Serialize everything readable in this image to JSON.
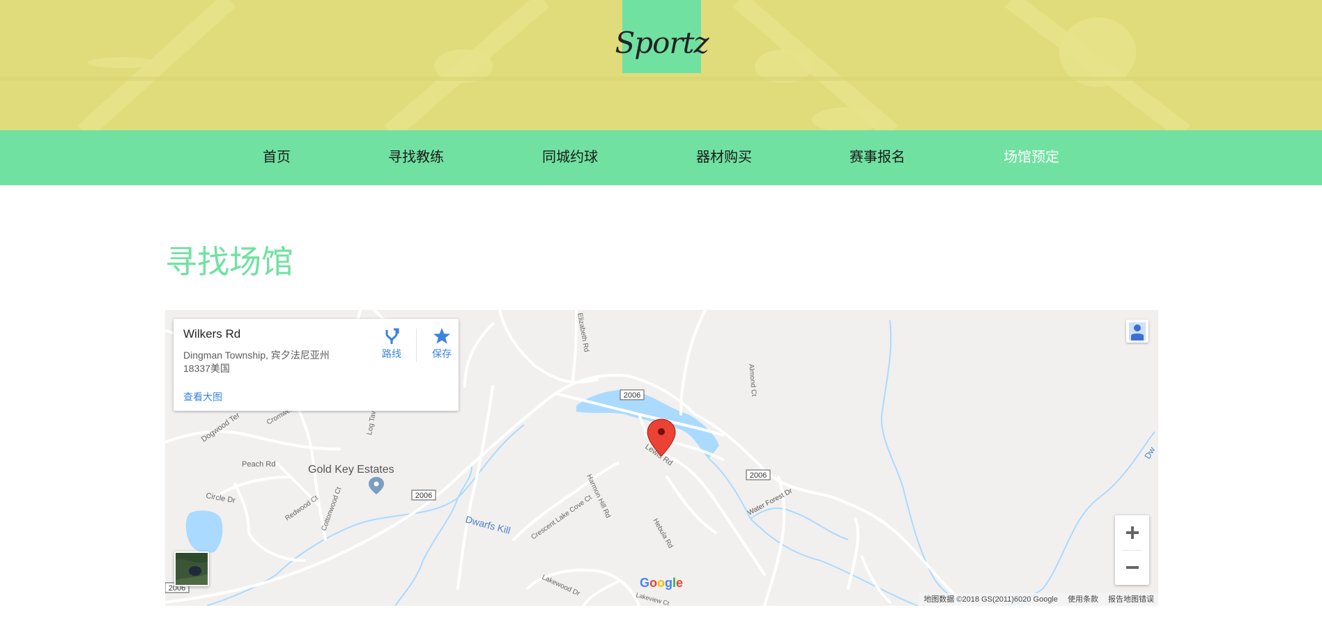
{
  "brand": {
    "logo_text": "Sportz"
  },
  "nav": {
    "items": [
      {
        "label": "首页"
      },
      {
        "label": "寻找教练"
      },
      {
        "label": "同城约球"
      },
      {
        "label": "器材购买"
      },
      {
        "label": "赛事报名"
      },
      {
        "label": "场馆预定"
      }
    ],
    "active_index": 5
  },
  "section": {
    "title": "寻找场馆"
  },
  "map": {
    "info_card": {
      "title": "Wilkers Rd",
      "address_line1": "Dingman Township, 宾夕法尼亚州",
      "address_line2": "18337美国",
      "view_larger": "查看大图",
      "directions_label": "路线",
      "save_label": "保存"
    },
    "labels": {
      "place": "Gold Key Estates",
      "peach_rd": "Peach Rd",
      "circle_dr": "Circle Dr",
      "dogwood": "Dogwood Ter",
      "cromwell": "Cromwell",
      "redwood": "Redwood Ct",
      "cottonwood": "Cottonwood Ct",
      "log_tavern": "Log Tav",
      "elizabeth": "Elizabeth Rd",
      "almond": "Almond Ct",
      "lewis": "Lewis Rd",
      "harmon": "Harmon Hill Rd",
      "hebula": "Hebula Rd",
      "crescent": "Crescent Lake Cove Ct",
      "lakewood": "Lakewood Dr",
      "lakeview": "Lakeview Ct",
      "water_forest": "Water Forest Dr",
      "dwarfs_kill": "Dwarfs Kill",
      "dw_edge": "Dw",
      "route_1": "2006",
      "route_2": "2006",
      "route_3": "2006",
      "route_4": "2006",
      "google": "Google"
    },
    "footer": {
      "attribution": "地图数据 ©2018 GS(2011)6020 Google",
      "terms": "使用条款",
      "report": "报告地图错误"
    },
    "colors": {
      "water": "#aadaff",
      "road": "#ffffff",
      "land": "#f1f0ef",
      "pin": "#ea4335"
    }
  },
  "colors": {
    "accent": "#70e1a1",
    "hero_bg": "#e0dc7b"
  }
}
